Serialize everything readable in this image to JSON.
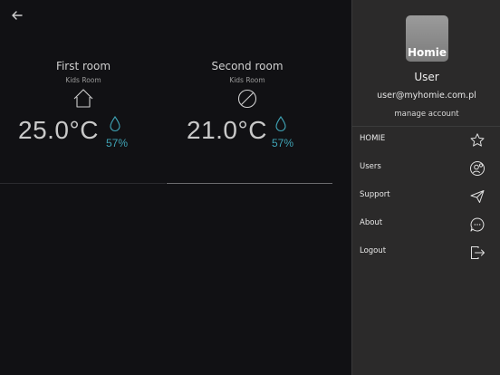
{
  "rooms": [
    {
      "name": "First room",
      "type": "Kids Room",
      "icon": "house-icon",
      "temperature": "25.0°C",
      "humidity": "57%"
    },
    {
      "name": "Second room",
      "type": "Kids Room",
      "icon": "no-device-icon",
      "temperature": "21.0°C",
      "humidity": "57%"
    }
  ],
  "drawer": {
    "logo_text": "Homie",
    "user_name": "User",
    "user_email": "user@myhomie.com.pl",
    "manage_label": "manage account",
    "menu": [
      {
        "label": "HOMIE",
        "icon": "star-icon"
      },
      {
        "label": "Users",
        "icon": "users-icon"
      },
      {
        "label": "Support",
        "icon": "send-icon"
      },
      {
        "label": "About",
        "icon": "chat-bubble-icon"
      },
      {
        "label": "Logout",
        "icon": "logout-icon"
      }
    ]
  },
  "colors": {
    "background": "#111114",
    "drawer": "#2b2a2a",
    "humidity_accent": "#3fa3b5"
  }
}
